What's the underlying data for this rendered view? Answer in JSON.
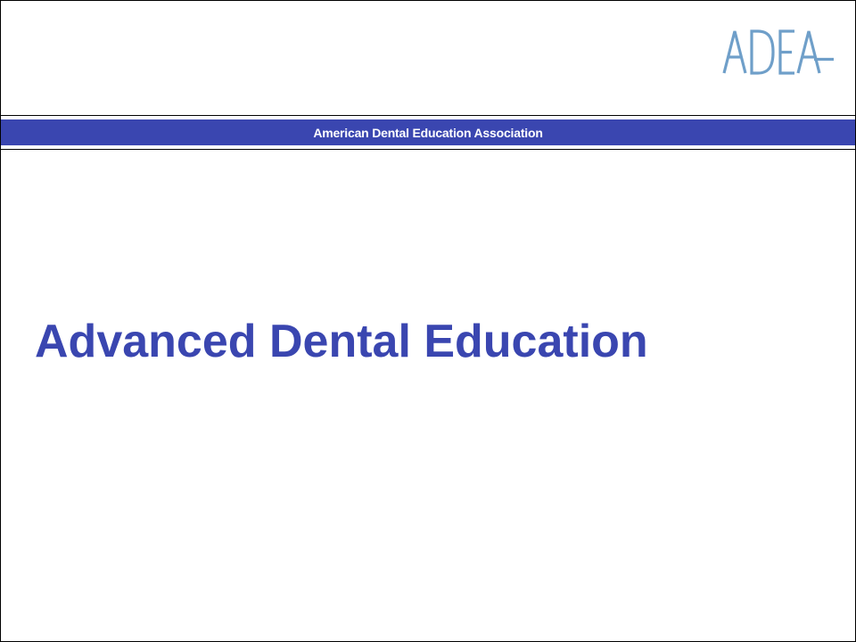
{
  "slide": {
    "logo_text": "ADEA",
    "banner_text": "American Dental Education Association",
    "title": "Advanced Dental Education"
  },
  "colors": {
    "brand_blue": "#3a46b0",
    "logo_blue": "#6f9fc9",
    "background": "#ffffff",
    "rule": "#000000"
  },
  "icons": {
    "logo": "adea-logo"
  }
}
